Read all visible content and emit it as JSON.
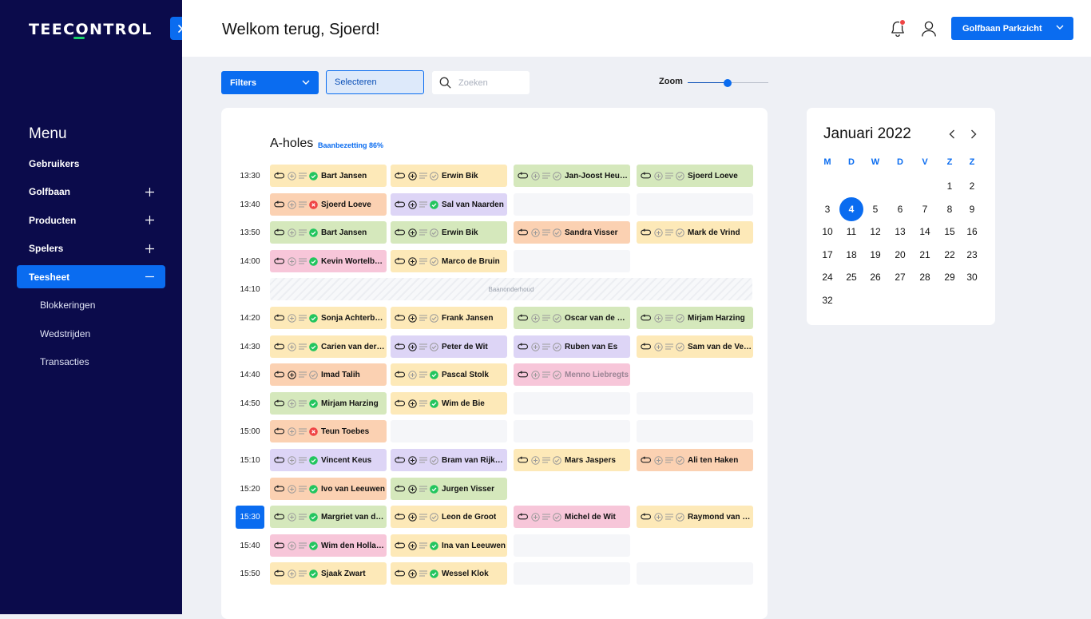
{
  "app": {
    "logo": "TEECONTROL"
  },
  "sidebar": {
    "menu_title": "Menu",
    "items": [
      {
        "label": "Gebruikers",
        "expandable": false,
        "expanded": false,
        "active": false
      },
      {
        "label": "Golfbaan",
        "expandable": true,
        "expanded": false,
        "active": false
      },
      {
        "label": "Producten",
        "expandable": true,
        "expanded": false,
        "active": false
      },
      {
        "label": "Spelers",
        "expandable": true,
        "expanded": false,
        "active": false
      },
      {
        "label": "Teesheet",
        "expandable": true,
        "expanded": true,
        "active": true
      }
    ],
    "subitems": [
      {
        "label": "Blokkeringen"
      },
      {
        "label": "Wedstrijden"
      },
      {
        "label": "Transacties"
      }
    ]
  },
  "header": {
    "welcome": "Welkom terug, Sjoerd!",
    "course_selector": "Golfbaan Parkzicht"
  },
  "toolbar": {
    "filters_label": "Filters",
    "select_label": "Selecteren",
    "search_placeholder": "Zoeken",
    "zoom_label": "Zoom",
    "zoom_level": 0.5
  },
  "teesheet": {
    "title": "A-holes",
    "occupancy": "Baanbezetting 86%",
    "maintenance_label": "Baanonderhoud",
    "current_time": "15:30",
    "rows": [
      {
        "time": "13:30",
        "slots": [
          {
            "name": "Bart Jansen",
            "color": "yellow",
            "status": "ok",
            "plus": false
          },
          {
            "name": "Erwin Bik",
            "color": "yellow",
            "status": "pending",
            "plus": true
          },
          {
            "name": "Jan-Joost Heuvel",
            "color": "green",
            "status": "pending",
            "plus": false
          },
          {
            "name": "Sjoerd Loeve",
            "color": "green",
            "status": "pending",
            "plus": false
          }
        ]
      },
      {
        "time": "13:40",
        "slots": [
          {
            "name": "Sjoerd Loeve",
            "color": "orange",
            "status": "error",
            "plus": false
          },
          {
            "name": "Sal van Naarden",
            "color": "purple",
            "status": "ok",
            "plus": true
          },
          null,
          null
        ]
      },
      {
        "time": "13:50",
        "slots": [
          {
            "name": "Bart Jansen",
            "color": "green",
            "status": "ok",
            "plus": false
          },
          {
            "name": "Erwin Bik",
            "color": "green",
            "status": "pending",
            "plus": true
          },
          {
            "name": "Sandra Visser",
            "color": "orange",
            "status": "pending",
            "plus": false
          },
          {
            "name": "Mark de Vrind",
            "color": "yellow",
            "status": "pending",
            "plus": false
          }
        ]
      },
      {
        "time": "14:00",
        "slots": [
          {
            "name": "Kevin Wortelboer",
            "color": "pink",
            "status": "ok",
            "plus": false
          },
          {
            "name": "Marco de Bruin",
            "color": "yellow",
            "status": "pending",
            "plus": true
          },
          null,
          "none"
        ]
      },
      {
        "time": "14:10",
        "maintenance": true
      },
      {
        "time": "14:20",
        "slots": [
          {
            "name": "Sonja Achterberg",
            "color": "yellow",
            "status": "ok",
            "plus": false
          },
          {
            "name": "Frank Jansen",
            "color": "yellow",
            "status": "pending",
            "plus": true
          },
          {
            "name": "Oscar van de Berg",
            "color": "green",
            "status": "pending",
            "plus": false
          },
          {
            "name": "Mirjam Harzing",
            "color": "green",
            "status": "pending",
            "plus": false
          }
        ]
      },
      {
        "time": "14:30",
        "slots": [
          {
            "name": "Carien van der Veen",
            "color": "yellow",
            "status": "ok",
            "plus": false
          },
          {
            "name": "Peter de Wit",
            "color": "purple",
            "status": "pending",
            "plus": true
          },
          {
            "name": "Ruben van Es",
            "color": "purple",
            "status": "pending",
            "plus": false
          },
          {
            "name": "Sam van de Velde",
            "color": "yellow",
            "status": "pending",
            "plus": false
          }
        ]
      },
      {
        "time": "14:40",
        "slots": [
          {
            "name": "Imad Talih",
            "color": "orange",
            "status": "pending",
            "plus": true
          },
          {
            "name": "Pascal Stolk",
            "color": "yellow",
            "status": "ok",
            "plus": false
          },
          {
            "name": "Menno Liebregts",
            "color": "pink",
            "status": "pending",
            "plus": false,
            "faded": true
          },
          "none"
        ]
      },
      {
        "time": "14:50",
        "slots": [
          {
            "name": "Mirjam Harzing",
            "color": "green",
            "status": "ok",
            "plus": false
          },
          {
            "name": "Wim de Bie",
            "color": "yellow",
            "status": "ok",
            "plus": true
          },
          null,
          null
        ]
      },
      {
        "time": "15:00",
        "slots": [
          {
            "name": "Teun Toebes",
            "color": "orange",
            "status": "error",
            "plus": false
          },
          null,
          null,
          null
        ]
      },
      {
        "time": "15:10",
        "slots": [
          {
            "name": "Vincent Keus",
            "color": "purple",
            "status": "ok",
            "plus": false
          },
          {
            "name": "Bram van Rijkevorsel",
            "color": "purple",
            "status": "pending",
            "plus": true
          },
          {
            "name": "Mars Jaspers",
            "color": "yellow",
            "status": "pending",
            "plus": false
          },
          {
            "name": "Ali ten Haken",
            "color": "orange",
            "status": "pending",
            "plus": false
          }
        ]
      },
      {
        "time": "15:20",
        "slots": [
          {
            "name": "Ivo van Leeuwen",
            "color": "orange",
            "status": "ok",
            "plus": false
          },
          {
            "name": "Jurgen Visser",
            "color": "green",
            "status": "ok",
            "plus": true
          },
          "none",
          "none"
        ]
      },
      {
        "time": "15:30",
        "slots": [
          {
            "name": "Margriet van der Ploeg",
            "color": "green",
            "status": "ok",
            "plus": false
          },
          {
            "name": "Leon de Groot",
            "color": "yellow",
            "status": "pending",
            "plus": true
          },
          {
            "name": "Michel de Wit",
            "color": "pink",
            "status": "pending",
            "plus": false
          },
          {
            "name": "Raymond van Tol",
            "color": "yellow",
            "status": "pending",
            "plus": false
          }
        ]
      },
      {
        "time": "15:40",
        "slots": [
          {
            "name": "Wim den Hollander",
            "color": "pink",
            "status": "ok",
            "plus": false
          },
          {
            "name": "Ina van Leeuwen",
            "color": "yellow",
            "status": "ok",
            "plus": true
          },
          null,
          "none"
        ]
      },
      {
        "time": "15:50",
        "slots": [
          {
            "name": "Sjaak Zwart",
            "color": "yellow",
            "status": "ok",
            "plus": false
          },
          {
            "name": "Wessel Klok",
            "color": "yellow",
            "status": "ok",
            "plus": true
          },
          null,
          null
        ]
      }
    ]
  },
  "calendar": {
    "month": "Januari 2022",
    "weekdays": [
      "M",
      "D",
      "W",
      "D",
      "V",
      "Z",
      "Z"
    ],
    "weeks": [
      [
        null,
        null,
        null,
        null,
        null,
        "1",
        "2"
      ],
      [
        "3",
        "4",
        "5",
        "6",
        "7",
        "8",
        "9"
      ],
      [
        "10",
        "11",
        "12",
        "13",
        "14",
        "15",
        "16"
      ],
      [
        "17",
        "18",
        "19",
        "20",
        "21",
        "22",
        "23"
      ],
      [
        "24",
        "25",
        "26",
        "27",
        "28",
        "29",
        "30"
      ],
      [
        "32",
        null,
        null,
        null,
        null,
        null,
        null
      ]
    ],
    "selected": "4"
  },
  "colors": {
    "primary": "#0a6cf0",
    "sidebar": "#0b0b4b",
    "accent_green": "#19d36a",
    "ok": "#22c55e",
    "error": "#ef4444",
    "yellow": "#fde9b8",
    "purple": "#ddd5f6",
    "green": "#d5e8bc",
    "orange": "#fbd1b2",
    "pink": "#f7c6d9"
  }
}
